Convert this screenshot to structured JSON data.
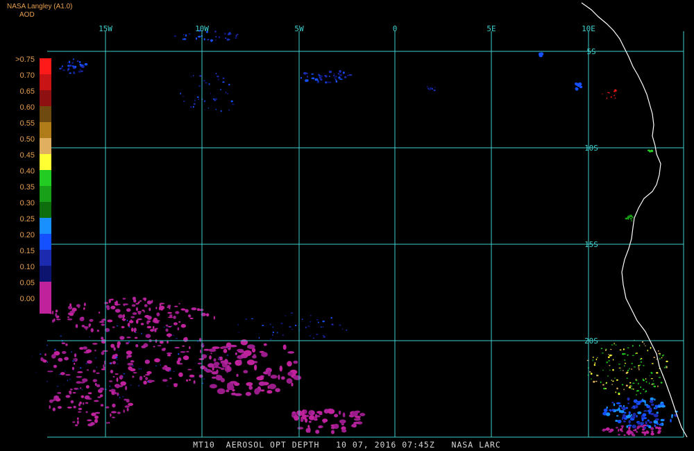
{
  "header": {
    "source": "NASA Langley (A1.0)",
    "product": "AOD"
  },
  "footer": {
    "text": "MT10  AEROSOL OPT DEPTH   10 07, 2016 07:45Z   NASA LARC"
  },
  "legend": {
    "labels": [
      ">0.75",
      "0.70",
      "0.65",
      "0.60",
      "0.55",
      "0.50",
      "0.45",
      "0.40",
      "0.35",
      "0.30",
      "0.25",
      "0.20",
      "0.15",
      "0.10",
      "0.05",
      "0.00"
    ],
    "colors": [
      "#ff1a1a",
      "#c81414",
      "#8e1010",
      "#6e4a10",
      "#b07c1a",
      "#e0b060",
      "#ffff33",
      "#22cc22",
      "#18a018",
      "#0e6e0e",
      "#1890ff",
      "#1450ff",
      "#1c2ab0",
      "#0d1470",
      "#c0229c",
      "#c0229c"
    ]
  },
  "grid": {
    "lon_labels": [
      "15W",
      "10W",
      "5W",
      "0",
      "5E",
      "10E"
    ],
    "lat_labels": [
      "5S",
      "10S",
      "15S",
      "20S"
    ],
    "color": "#40d0d0"
  },
  "colors": {
    "coast": "#ffffff",
    "background": "#000000",
    "label_orange": "#e8a050"
  }
}
